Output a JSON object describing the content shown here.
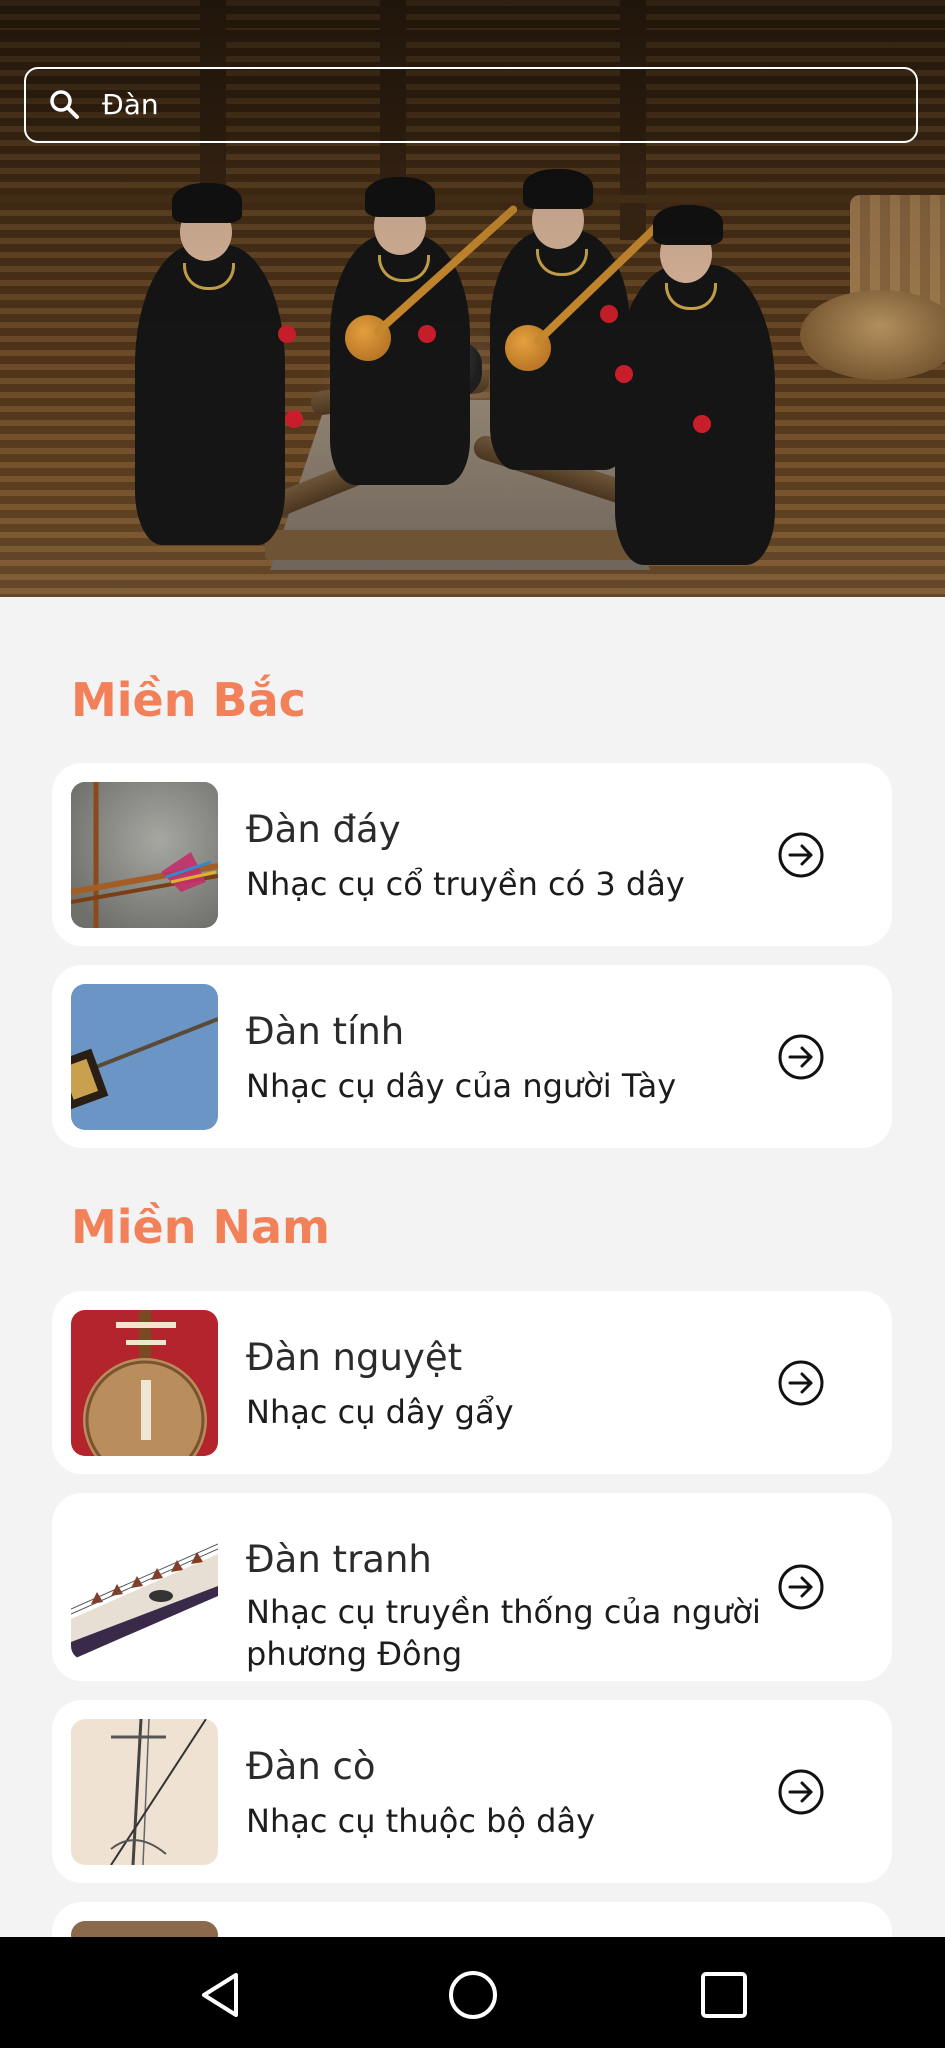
{
  "search": {
    "query": "Đàn",
    "icon": "search-icon"
  },
  "sections": [
    {
      "title": "Miền Bắc",
      "items": [
        {
          "name": "Đàn đáy",
          "description": "Nhạc cụ cổ truyền có 3 dây",
          "icon": "arrow-circle-right-icon"
        },
        {
          "name": "Đàn tính",
          "description": "Nhạc cụ dây của người Tày",
          "icon": "arrow-circle-right-icon"
        }
      ]
    },
    {
      "title": "Miền Nam",
      "items": [
        {
          "name": "Đàn nguyệt",
          "description": "Nhạc cụ dây gẩy",
          "icon": "arrow-circle-right-icon"
        },
        {
          "name": "Đàn tranh",
          "description": "Nhạc cụ truyền thống của người phương Đông",
          "icon": "arrow-circle-right-icon"
        },
        {
          "name": "Đàn cò",
          "description": "Nhạc cụ thuộc bộ dây",
          "icon": "arrow-circle-right-icon"
        }
      ]
    }
  ],
  "colors": {
    "accent": "#f2815a",
    "background": "#f3f3f3",
    "card": "#ffffff",
    "navbar": "#000000"
  },
  "navbar": {
    "back": "back-triangle-icon",
    "home": "home-circle-icon",
    "recents": "recents-square-icon"
  }
}
